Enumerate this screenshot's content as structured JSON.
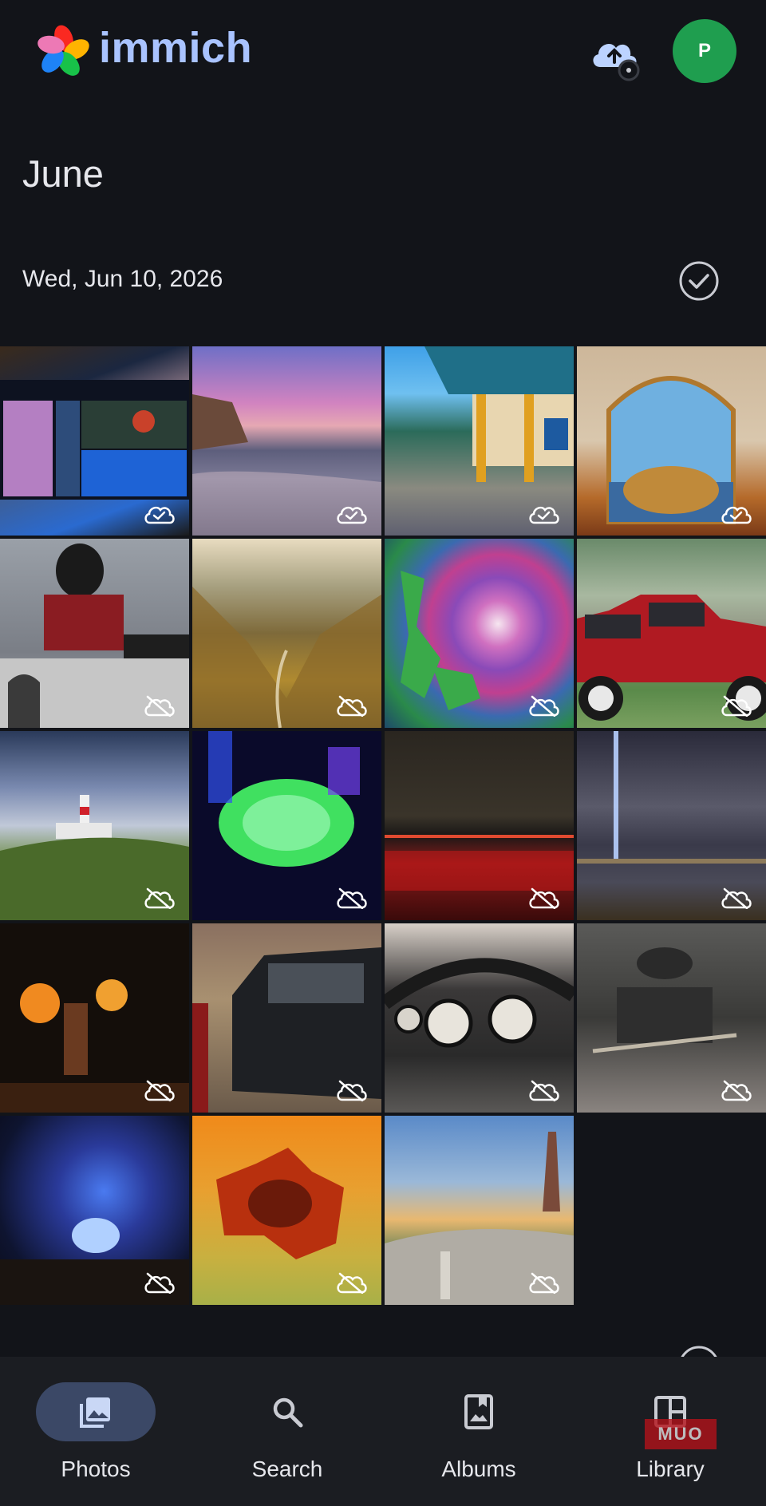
{
  "header": {
    "brand": "immich",
    "avatar_initial": "P"
  },
  "timeline": {
    "month": "June",
    "date_label": "Wed, Jun 10, 2026"
  },
  "tiles": [
    {
      "desc": "monitor-weather-map",
      "status": "uploaded"
    },
    {
      "desc": "coastal-sunset",
      "status": "uploaded"
    },
    {
      "desc": "temple-building",
      "status": "uploaded"
    },
    {
      "desc": "ornate-window",
      "status": "uploaded"
    },
    {
      "desc": "mural-building",
      "status": "not-backed-up"
    },
    {
      "desc": "mountain-valley",
      "status": "not-backed-up"
    },
    {
      "desc": "cyclone-map",
      "status": "not-backed-up"
    },
    {
      "desc": "red-suv",
      "status": "not-backed-up"
    },
    {
      "desc": "lighthouse-hill",
      "status": "not-backed-up"
    },
    {
      "desc": "uv-glass-plate",
      "status": "not-backed-up"
    },
    {
      "desc": "night-bridge",
      "status": "not-backed-up"
    },
    {
      "desc": "light-beam-storm",
      "status": "not-backed-up"
    },
    {
      "desc": "fire-performer",
      "status": "not-backed-up"
    },
    {
      "desc": "black-car-garage",
      "status": "not-backed-up"
    },
    {
      "desc": "car-dashboard",
      "status": "not-backed-up"
    },
    {
      "desc": "engine-bay",
      "status": "not-backed-up"
    },
    {
      "desc": "light-show-crowd",
      "status": "not-backed-up"
    },
    {
      "desc": "australia-heatmap",
      "status": "not-backed-up"
    },
    {
      "desc": "lighthouse-path",
      "status": "not-backed-up"
    }
  ],
  "nav": {
    "photos": "Photos",
    "search": "Search",
    "albums": "Albums",
    "library": "Library"
  },
  "watermark": "MUO",
  "colors": {
    "background": "#121419",
    "brand": "#a9c3ff",
    "avatar": "#1f9e4f",
    "nav_active": "#3b4866"
  }
}
